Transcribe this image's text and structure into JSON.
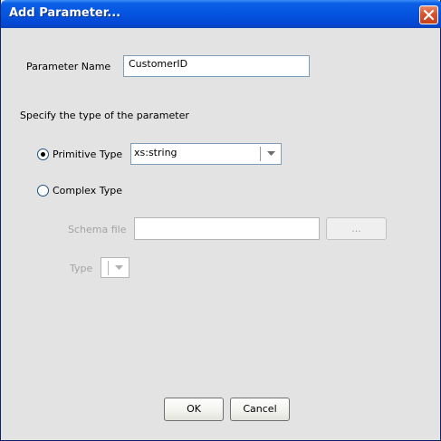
{
  "window": {
    "title": "Add Parameter..."
  },
  "param_name": {
    "label": "Parameter Name",
    "value": "CustomerID"
  },
  "type_section": {
    "heading": "Specify the type of the parameter",
    "primitive_label": "Primitive Type",
    "primitive_selected": true,
    "primitive_value": "xs:string",
    "complex_label": "Complex Type",
    "complex_selected": false,
    "schema_file_label": "Schema file",
    "schema_file_value": "",
    "browse_label": "...",
    "type_label": "Type",
    "type_value": ""
  },
  "buttons": {
    "ok": "OK",
    "cancel": "Cancel"
  },
  "colors": {
    "titlebar": "#0554e0",
    "dialog_bg": "#e3e3e3",
    "close_button": "#d9532d",
    "disabled_text": "#a3a3a3"
  },
  "icons": {
    "close": "close-icon",
    "dropdown": "chevron-down-icon"
  }
}
